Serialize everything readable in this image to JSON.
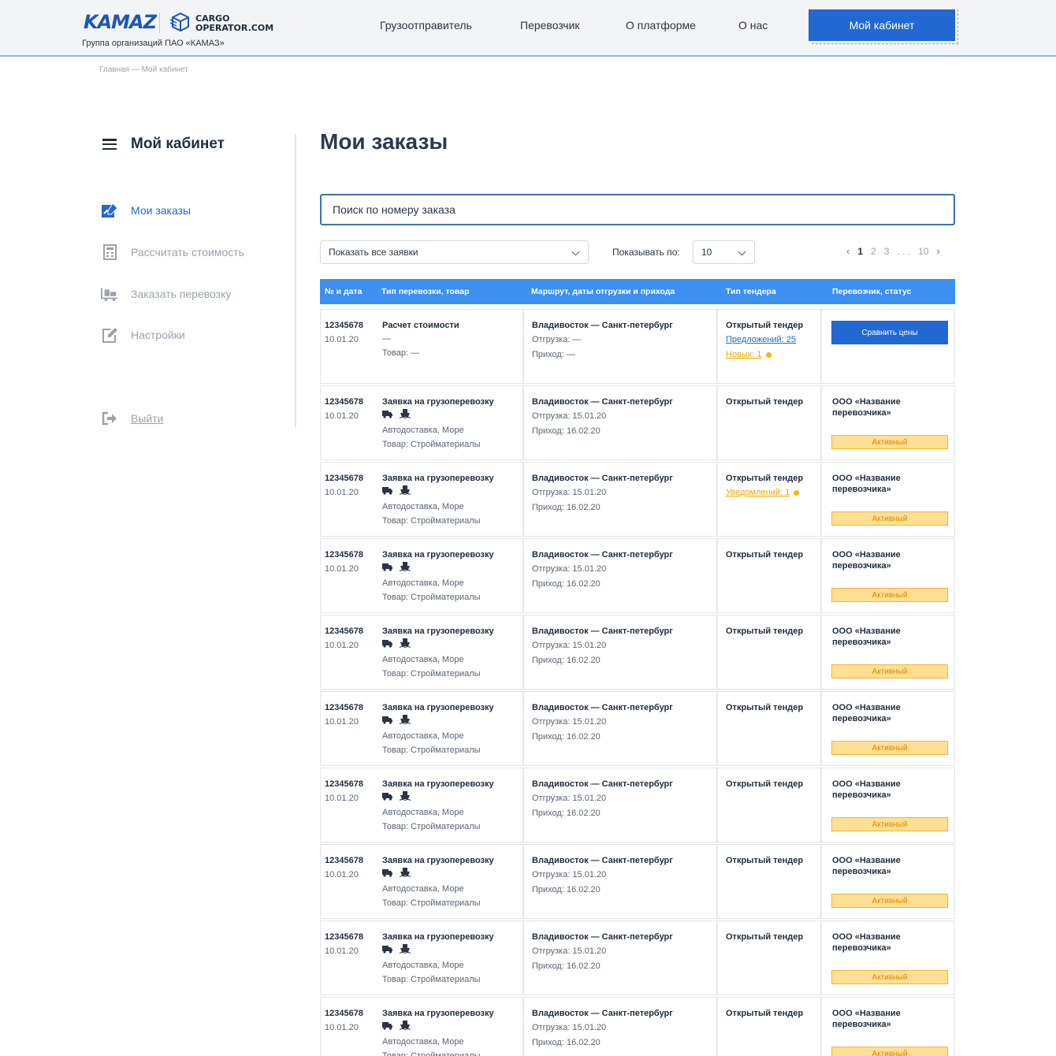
{
  "header": {
    "logo": "KAMAZ",
    "brand_line1": "CARGO",
    "brand_line2": "OPERATOR.COM",
    "subtitle": "Группа организаций ПАО «КАМАЗ»",
    "nav": [
      "Грузоотправитель",
      "Перевозчик",
      "О платформе",
      "О нас"
    ],
    "cabinet_button": "Мой кабинет"
  },
  "breadcrumb": "Главная — Мой кабинет",
  "sidebar": {
    "title": "Мой кабинет",
    "items": [
      {
        "label": "Мои заказы",
        "icon": "orders-icon",
        "active": true
      },
      {
        "label": "Рассчитать стоимость",
        "icon": "calculator-icon",
        "active": false
      },
      {
        "label": "Заказать перевозку",
        "icon": "truck-order-icon",
        "active": false
      },
      {
        "label": "Настройки",
        "icon": "edit-icon",
        "active": false
      }
    ],
    "logout": "Выйти"
  },
  "main": {
    "title": "Мои заказы",
    "search_placeholder": "Поиск по номеру заказа",
    "filter_value": "Показать все заявки",
    "per_page_label": "Показывать по:",
    "per_page_value": "10",
    "pagination": {
      "prev": "‹",
      "pages": [
        "1",
        "2",
        "3"
      ],
      "ellipsis": ". . .",
      "last": "10",
      "next": "›",
      "current": "1"
    }
  },
  "table": {
    "headers": [
      "№ и дата",
      "Тип перевозки, товар",
      "Маршрут, даты отгрузки и прихода",
      "Тип тендера",
      "Перевозчик, статус"
    ],
    "first_row": {
      "number": "12345678",
      "date": "10.01.20",
      "type": "Расчет стоимости",
      "dash": "—",
      "goods": "Товар: —",
      "route": "Владивосток — Санкт-петербург",
      "shipment": "Отгрузка: —",
      "arrival": "Приход: —",
      "tender": "Открытый тендер",
      "offers": "Предложений: 25",
      "new": "Новых: 1",
      "action": "Сравнить цены"
    },
    "rows": [
      {
        "number": "12345678",
        "date": "10.01.20",
        "type": "Заявка на грузоперевозку",
        "delivery": "Автодоставка, Море",
        "goods": "Товар: Стройматериалы",
        "route": "Владивосток — Санкт-петербург",
        "shipment": "Отгрузка: 15.01.20",
        "arrival": "Приход: 16.02.20",
        "tender": "Открытый тендер",
        "notice": "",
        "carrier1": "ООО «Название",
        "carrier2": "перевозчика»",
        "status": "Активный"
      },
      {
        "number": "12345678",
        "date": "10.01.20",
        "type": "Заявка на грузоперевозку",
        "delivery": "Автодоставка, Море",
        "goods": "Товар: Стройматериалы",
        "route": "Владивосток — Санкт-петербург",
        "shipment": "Отгрузка: 15.01.20",
        "arrival": "Приход: 16.02.20",
        "tender": "Открытый тендер",
        "notice": "Уведомлений: 1",
        "carrier1": "ООО «Название",
        "carrier2": "перевозчика»",
        "status": "Активный"
      },
      {
        "number": "12345678",
        "date": "10.01.20",
        "type": "Заявка на грузоперевозку",
        "delivery": "Автодоставка, Море",
        "goods": "Товар: Стройматериалы",
        "route": "Владивосток — Санкт-петербург",
        "shipment": "Отгрузка: 15.01.20",
        "arrival": "Приход: 16.02.20",
        "tender": "Открытый тендер",
        "notice": "",
        "carrier1": "ООО «Название",
        "carrier2": "перевозчика»",
        "status": "Активный"
      },
      {
        "number": "12345678",
        "date": "10.01.20",
        "type": "Заявка на грузоперевозку",
        "delivery": "Автодоставка, Море",
        "goods": "Товар: Стройматериалы",
        "route": "Владивосток — Санкт-петербург",
        "shipment": "Отгрузка: 15.01.20",
        "arrival": "Приход: 16.02.20",
        "tender": "Открытый тендер",
        "notice": "",
        "carrier1": "ООО «Название",
        "carrier2": "перевозчика»",
        "status": "Активный"
      },
      {
        "number": "12345678",
        "date": "10.01.20",
        "type": "Заявка на грузоперевозку",
        "delivery": "Автодоставка, Море",
        "goods": "Товар: Стройматериалы",
        "route": "Владивосток — Санкт-петербург",
        "shipment": "Отгрузка: 15.01.20",
        "arrival": "Приход: 16.02.20",
        "tender": "Открытый тендер",
        "notice": "",
        "carrier1": "ООО «Название",
        "carrier2": "перевозчика»",
        "status": "Активный"
      },
      {
        "number": "12345678",
        "date": "10.01.20",
        "type": "Заявка на грузоперевозку",
        "delivery": "Автодоставка, Море",
        "goods": "Товар: Стройматериалы",
        "route": "Владивосток — Санкт-петербург",
        "shipment": "Отгрузка: 15.01.20",
        "arrival": "Приход: 16.02.20",
        "tender": "Открытый тендер",
        "notice": "",
        "carrier1": "ООО «Название",
        "carrier2": "перевозчика»",
        "status": "Активный"
      },
      {
        "number": "12345678",
        "date": "10.01.20",
        "type": "Заявка на грузоперевозку",
        "delivery": "Автодоставка, Море",
        "goods": "Товар: Стройматериалы",
        "route": "Владивосток — Санкт-петербург",
        "shipment": "Отгрузка: 15.01.20",
        "arrival": "Приход: 16.02.20",
        "tender": "Открытый тендер",
        "notice": "",
        "carrier1": "ООО «Название",
        "carrier2": "перевозчика»",
        "status": "Активный"
      },
      {
        "number": "12345678",
        "date": "10.01.20",
        "type": "Заявка на грузоперевозку",
        "delivery": "Автодоставка, Море",
        "goods": "Товар: Стройматериалы",
        "route": "Владивосток — Санкт-петербург",
        "shipment": "Отгрузка: 15.01.20",
        "arrival": "Приход: 16.02.20",
        "tender": "Открытый тендер",
        "notice": "",
        "carrier1": "ООО «Название",
        "carrier2": "перевозчика»",
        "status": "Активный"
      },
      {
        "number": "12345678",
        "date": "10.01.20",
        "type": "Заявка на грузоперевозку",
        "delivery": "Автодоставка, Море",
        "goods": "Товар: Стройматериалы",
        "route": "Владивосток — Санкт-петербург",
        "shipment": "Отгрузка: 15.01.20",
        "arrival": "Приход: 16.02.20",
        "tender": "Открытый тендер",
        "notice": "",
        "carrier1": "ООО «Название",
        "carrier2": "перевозчика»",
        "status": "Активный"
      }
    ]
  },
  "colors": {
    "accent": "#2168d2",
    "table_header": "#3d8ff0",
    "status_bg": "#ffdf93",
    "status_text": "#d98a00",
    "notice": "#f0a800"
  }
}
